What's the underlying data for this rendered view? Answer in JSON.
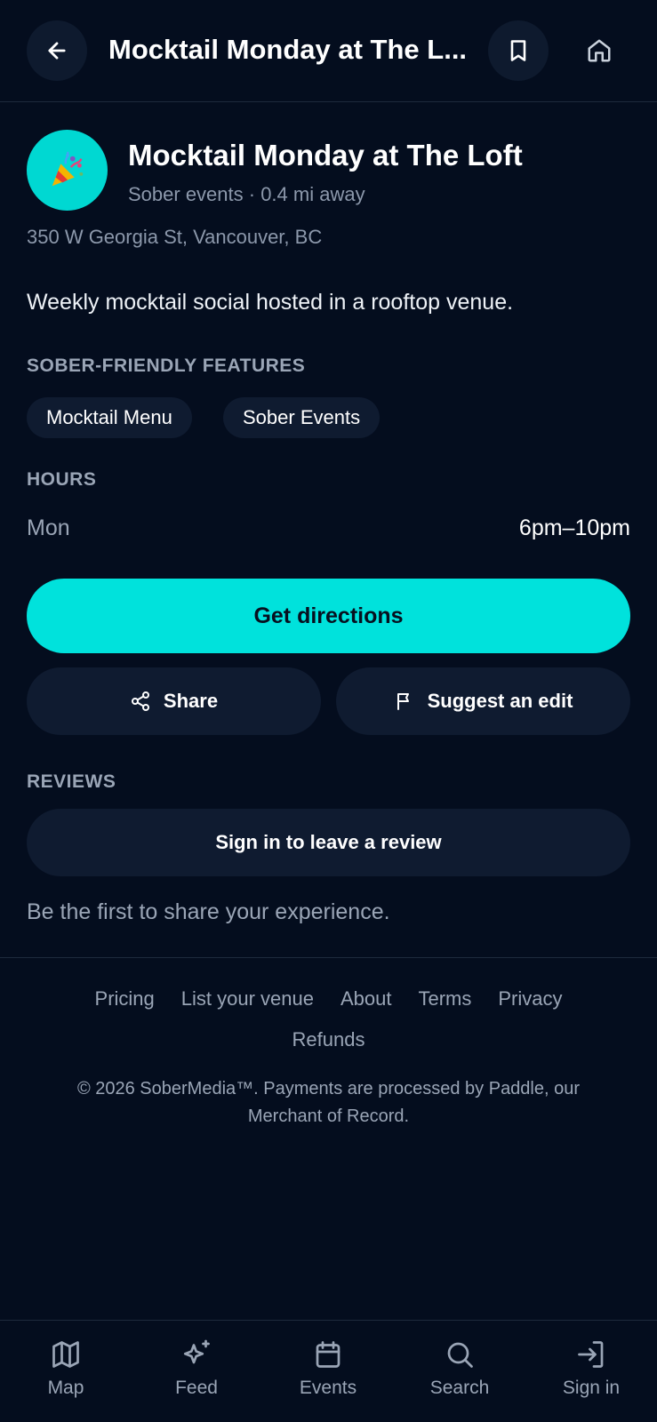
{
  "topbar": {
    "title": "Mocktail Monday at The L...",
    "back_icon": "arrow-left-icon",
    "bookmark_icon": "bookmark-icon",
    "home_icon": "home-icon"
  },
  "venue": {
    "icon": "party-popper-icon",
    "title": "Mocktail Monday at The Loft",
    "subtitle": "Sober events · 0.4 mi away",
    "address": "350 W Georgia St, Vancouver, BC",
    "description": "Weekly mocktail social hosted in a rooftop venue."
  },
  "features": {
    "label": "SOBER-FRIENDLY FEATURES",
    "chips": [
      "Mocktail Menu",
      "Sober Events"
    ]
  },
  "hours": {
    "label": "HOURS",
    "rows": [
      {
        "day": "Mon",
        "time": "6pm–10pm"
      }
    ]
  },
  "actions": {
    "directions": "Get directions",
    "share": "Share",
    "suggest_edit": "Suggest an edit"
  },
  "reviews": {
    "label": "REVIEWS",
    "sign_in": "Sign in to leave a review",
    "empty": "Be the first to share your experience."
  },
  "footer": {
    "links": [
      "Pricing",
      "List your venue",
      "About",
      "Terms",
      "Privacy"
    ],
    "links_2": [
      "Refunds"
    ],
    "copyright": "© 2026 SoberMedia™. Payments are processed by Paddle, our Merchant of Record."
  },
  "nav": [
    {
      "label": "Map",
      "icon": "map-icon"
    },
    {
      "label": "Feed",
      "icon": "sparkles-icon"
    },
    {
      "label": "Events",
      "icon": "calendar-icon"
    },
    {
      "label": "Search",
      "icon": "search-icon"
    },
    {
      "label": "Sign in",
      "icon": "sign-in-icon"
    }
  ],
  "colors": {
    "background": "#040d1e",
    "accent": "#00e2dc",
    "surface": "#0f1b30",
    "muted_text": "#9aa5b6"
  }
}
